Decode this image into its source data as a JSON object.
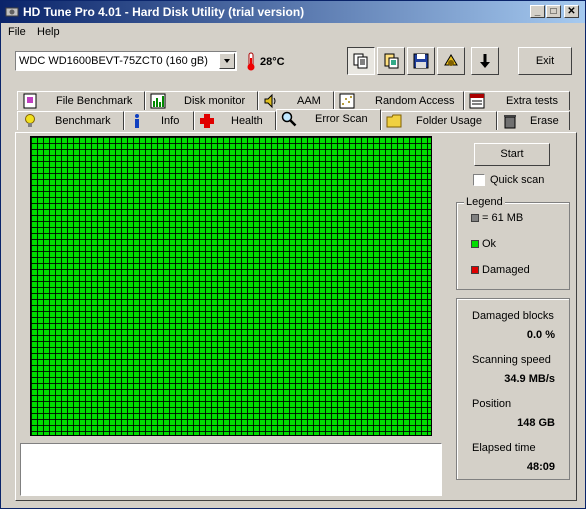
{
  "window": {
    "title": "HD Tune Pro 4.01 - Hard Disk Utility (trial version)"
  },
  "menu": {
    "file": "File",
    "help": "Help"
  },
  "toolbar": {
    "drive": "WDC WD1600BEVT-75ZCT0 (160 gB)",
    "temperature": "28°C",
    "exit_label": "Exit"
  },
  "tabs": {
    "row1": [
      {
        "label": "File Benchmark",
        "icon": "file-benchmark-icon"
      },
      {
        "label": "Disk monitor",
        "icon": "disk-monitor-icon"
      },
      {
        "label": "AAM",
        "icon": "speaker-icon"
      },
      {
        "label": "Random Access",
        "icon": "random-access-icon"
      },
      {
        "label": "Extra tests",
        "icon": "extra-tests-icon"
      }
    ],
    "row2": [
      {
        "label": "Benchmark",
        "icon": "lightbulb-icon"
      },
      {
        "label": "Info",
        "icon": "info-icon"
      },
      {
        "label": "Health",
        "icon": "health-cross-icon"
      },
      {
        "label": "Error Scan",
        "icon": "magnifier-icon",
        "active": true
      },
      {
        "label": "Folder Usage",
        "icon": "folder-icon"
      },
      {
        "label": "Erase",
        "icon": "trash-icon"
      }
    ]
  },
  "scan": {
    "start_label": "Start",
    "quick_scan_label": "Quick scan",
    "quick_scan_checked": false,
    "legend_title": "Legend",
    "legend": [
      {
        "label": "= 61 MB",
        "color": "#808080"
      },
      {
        "label": "Ok",
        "color": "#00dd00"
      },
      {
        "label": "Damaged",
        "color": "#dd0000"
      }
    ],
    "stats": {
      "damaged_blocks_label": "Damaged blocks",
      "damaged_blocks": "0.0 %",
      "scanning_speed_label": "Scanning speed",
      "scanning_speed": "34.9 MB/s",
      "position_label": "Position",
      "position": "148 GB",
      "elapsed_label": "Elapsed time",
      "elapsed": "48:09"
    },
    "grid_color": "#00dd00"
  }
}
